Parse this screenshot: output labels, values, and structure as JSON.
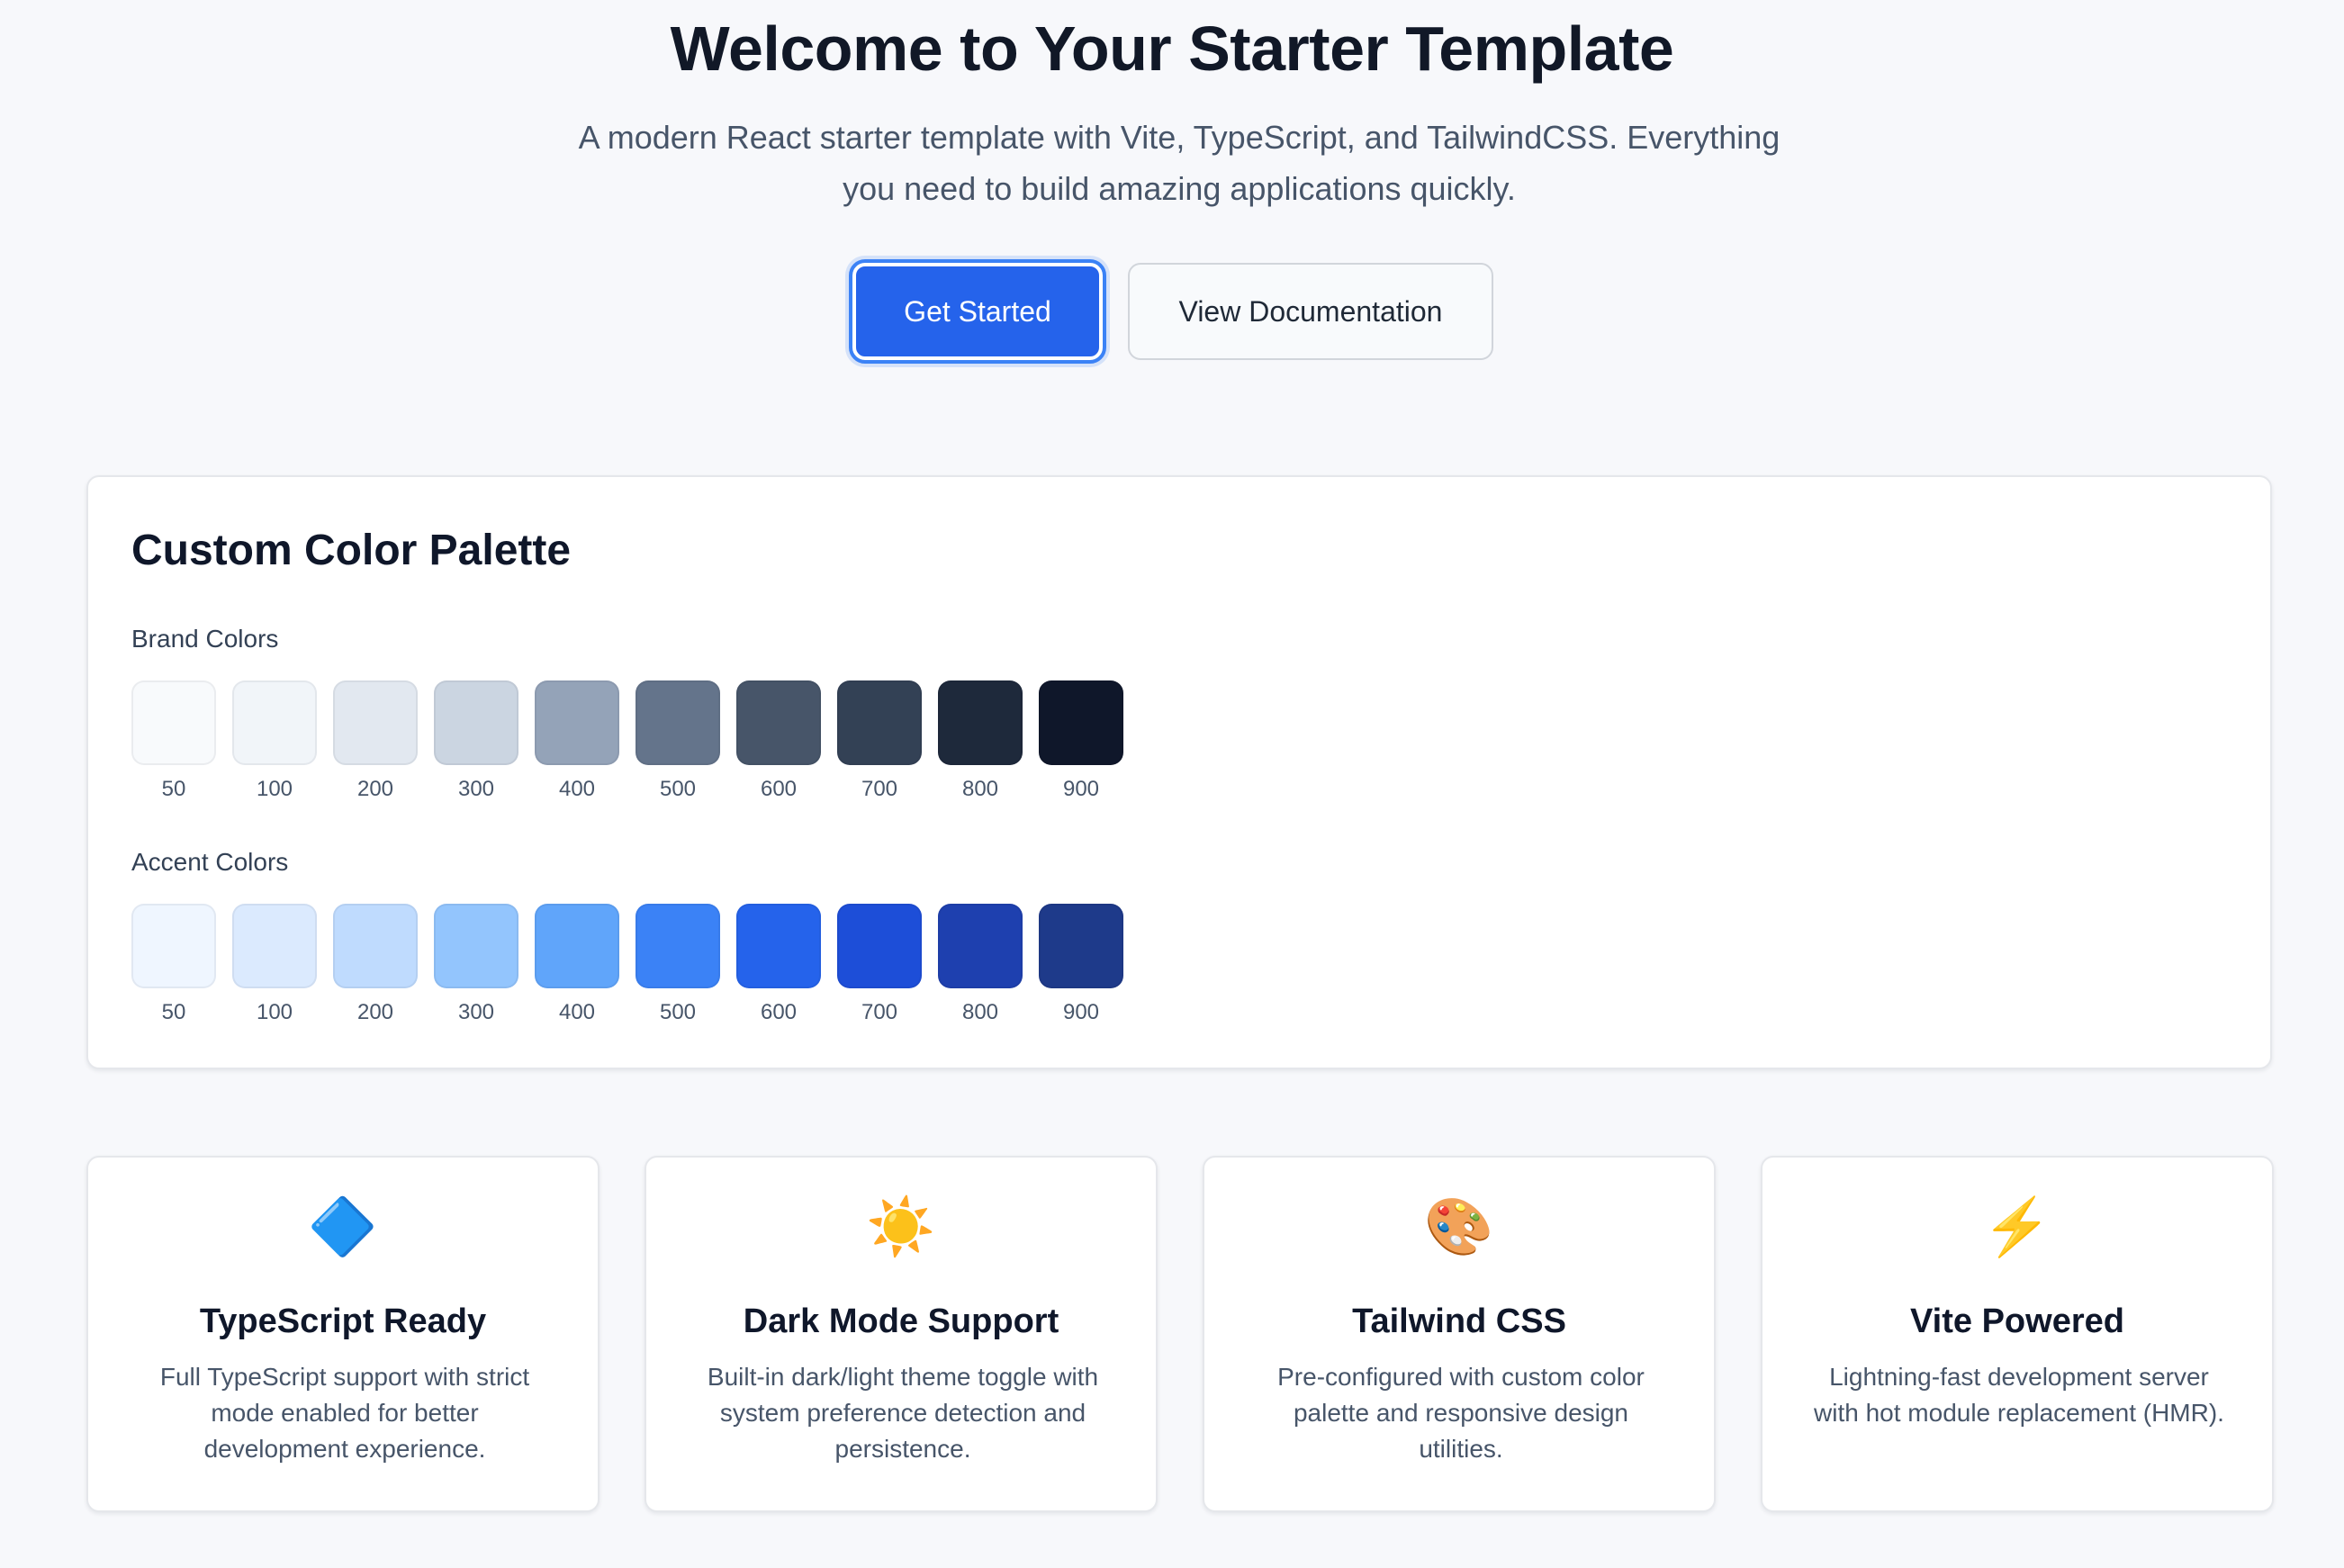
{
  "hero": {
    "title": "Welcome to Your Starter Template",
    "subtitle": "A modern React starter template with Vite, TypeScript, and TailwindCSS. Everything you need to build amazing applications quickly.",
    "primary_button": "Get Started",
    "secondary_button": "View Documentation"
  },
  "palette": {
    "title": "Custom Color Palette",
    "brand": {
      "label": "Brand Colors",
      "items": [
        {
          "shade": "50",
          "color": "#f8fafc"
        },
        {
          "shade": "100",
          "color": "#f1f5f9"
        },
        {
          "shade": "200",
          "color": "#e2e8f0"
        },
        {
          "shade": "300",
          "color": "#cbd5e1"
        },
        {
          "shade": "400",
          "color": "#94a3b8"
        },
        {
          "shade": "500",
          "color": "#64748b"
        },
        {
          "shade": "600",
          "color": "#475569"
        },
        {
          "shade": "700",
          "color": "#334155"
        },
        {
          "shade": "800",
          "color": "#1e293b"
        },
        {
          "shade": "900",
          "color": "#0f172a"
        }
      ]
    },
    "accent": {
      "label": "Accent Colors",
      "items": [
        {
          "shade": "50",
          "color": "#eff6ff"
        },
        {
          "shade": "100",
          "color": "#dbeafe"
        },
        {
          "shade": "200",
          "color": "#bfdbfe"
        },
        {
          "shade": "300",
          "color": "#93c5fd"
        },
        {
          "shade": "400",
          "color": "#60a5fa"
        },
        {
          "shade": "500",
          "color": "#3b82f6"
        },
        {
          "shade": "600",
          "color": "#2563eb"
        },
        {
          "shade": "700",
          "color": "#1d4ed8"
        },
        {
          "shade": "800",
          "color": "#1e40af"
        },
        {
          "shade": "900",
          "color": "#1e3a8a"
        }
      ]
    }
  },
  "features": [
    {
      "icon": "🔷",
      "icon_name": "typescript-diamond-icon",
      "title": "TypeScript Ready",
      "text": "Full TypeScript support with strict mode enabled for better development experience."
    },
    {
      "icon": "☀️",
      "icon_name": "sun-icon",
      "title": "Dark Mode Support",
      "text": "Built-in dark/light theme toggle with system preference detection and persistence."
    },
    {
      "icon": "🎨",
      "icon_name": "palette-icon",
      "title": "Tailwind CSS",
      "text": "Pre-configured with custom color palette and responsive design utilities."
    },
    {
      "icon": "⚡",
      "icon_name": "lightning-icon",
      "title": "Vite Powered",
      "text": "Lightning-fast development server with hot module replacement (HMR)."
    }
  ]
}
